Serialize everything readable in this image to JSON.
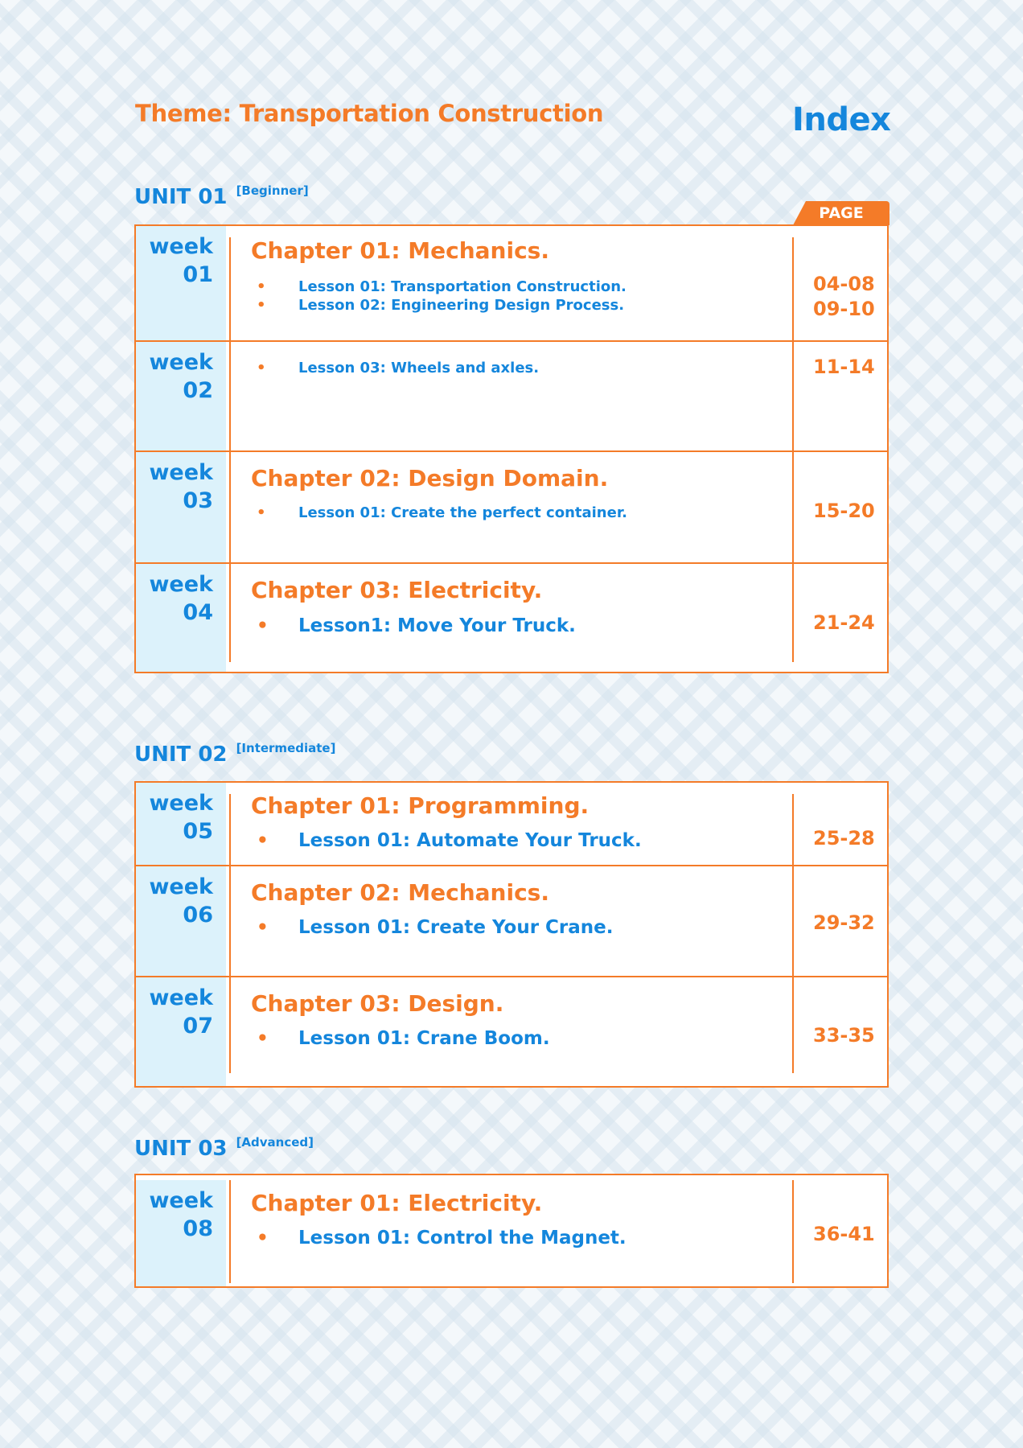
{
  "header": {
    "theme": "Theme: Transportation Construction",
    "index_title": "Index",
    "page_column_label": "PAGE"
  },
  "units": [
    {
      "title": "UNIT 01",
      "level": "[Beginner]",
      "rows": [
        {
          "week_label": "week",
          "week_num": "01",
          "chapter": "Chapter 01: Mechanics.",
          "lessons": [
            "Lesson 01: Transportation Construction.",
            "Lesson 02: Engineering Design Process."
          ],
          "pages": [
            "04-08",
            "09-10"
          ]
        },
        {
          "week_label": "week",
          "week_num": "02",
          "chapter": "",
          "lessons": [
            "Lesson 03: Wheels and axles."
          ],
          "pages": [
            "11-14"
          ]
        },
        {
          "week_label": "week",
          "week_num": "03",
          "chapter": "Chapter 02: Design Domain.",
          "lessons": [
            "Lesson 01: Create the perfect container."
          ],
          "pages": [
            "15-20"
          ]
        },
        {
          "week_label": "week",
          "week_num": "04",
          "chapter": "Chapter 03: Electricity.",
          "lessons": [
            "Lesson1: Move Your Truck."
          ],
          "pages": [
            "21-24"
          ]
        }
      ]
    },
    {
      "title": "UNIT 02",
      "level": "[Intermediate]",
      "rows": [
        {
          "week_label": "week",
          "week_num": "05",
          "chapter": "Chapter 01: Programming.",
          "lessons": [
            "Lesson 01: Automate Your Truck."
          ],
          "pages": [
            "25-28"
          ]
        },
        {
          "week_label": "week",
          "week_num": "06",
          "chapter": "Chapter 02: Mechanics.",
          "lessons": [
            "Lesson 01: Create Your Crane."
          ],
          "pages": [
            "29-32"
          ]
        },
        {
          "week_label": "week",
          "week_num": "07",
          "chapter": "Chapter 03: Design.",
          "lessons": [
            "Lesson 01: Crane Boom."
          ],
          "pages": [
            "33-35"
          ]
        }
      ]
    },
    {
      "title": "UNIT 03",
      "level": "[Advanced]",
      "rows": [
        {
          "week_label": "week",
          "week_num": "08",
          "chapter": "Chapter 01: Electricity.",
          "lessons": [
            "Lesson 01: Control the Magnet."
          ],
          "pages": [
            "36-41"
          ]
        }
      ]
    }
  ],
  "colors": {
    "orange": "#f47b28",
    "blue": "#1486dc",
    "week_bg": "#dcf2fb"
  }
}
